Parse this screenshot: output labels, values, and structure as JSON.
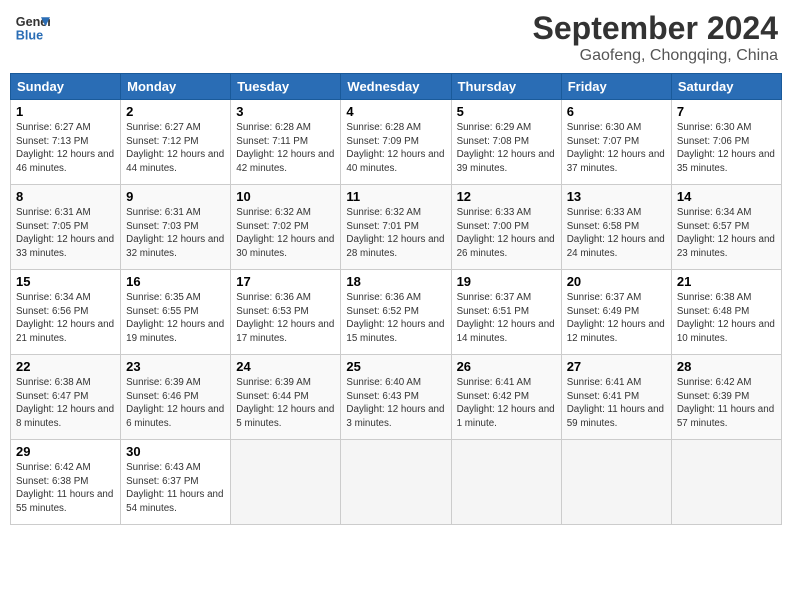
{
  "header": {
    "logo_line1": "General",
    "logo_line2": "Blue",
    "month_year": "September 2024",
    "location": "Gaofeng, Chongqing, China"
  },
  "days_of_week": [
    "Sunday",
    "Monday",
    "Tuesday",
    "Wednesday",
    "Thursday",
    "Friday",
    "Saturday"
  ],
  "weeks": [
    [
      {
        "day": 1,
        "sunrise": "6:27 AM",
        "sunset": "7:13 PM",
        "daylight": "12 hours and 46 minutes."
      },
      {
        "day": 2,
        "sunrise": "6:27 AM",
        "sunset": "7:12 PM",
        "daylight": "12 hours and 44 minutes."
      },
      {
        "day": 3,
        "sunrise": "6:28 AM",
        "sunset": "7:11 PM",
        "daylight": "12 hours and 42 minutes."
      },
      {
        "day": 4,
        "sunrise": "6:28 AM",
        "sunset": "7:09 PM",
        "daylight": "12 hours and 40 minutes."
      },
      {
        "day": 5,
        "sunrise": "6:29 AM",
        "sunset": "7:08 PM",
        "daylight": "12 hours and 39 minutes."
      },
      {
        "day": 6,
        "sunrise": "6:30 AM",
        "sunset": "7:07 PM",
        "daylight": "12 hours and 37 minutes."
      },
      {
        "day": 7,
        "sunrise": "6:30 AM",
        "sunset": "7:06 PM",
        "daylight": "12 hours and 35 minutes."
      }
    ],
    [
      {
        "day": 8,
        "sunrise": "6:31 AM",
        "sunset": "7:05 PM",
        "daylight": "12 hours and 33 minutes."
      },
      {
        "day": 9,
        "sunrise": "6:31 AM",
        "sunset": "7:03 PM",
        "daylight": "12 hours and 32 minutes."
      },
      {
        "day": 10,
        "sunrise": "6:32 AM",
        "sunset": "7:02 PM",
        "daylight": "12 hours and 30 minutes."
      },
      {
        "day": 11,
        "sunrise": "6:32 AM",
        "sunset": "7:01 PM",
        "daylight": "12 hours and 28 minutes."
      },
      {
        "day": 12,
        "sunrise": "6:33 AM",
        "sunset": "7:00 PM",
        "daylight": "12 hours and 26 minutes."
      },
      {
        "day": 13,
        "sunrise": "6:33 AM",
        "sunset": "6:58 PM",
        "daylight": "12 hours and 24 minutes."
      },
      {
        "day": 14,
        "sunrise": "6:34 AM",
        "sunset": "6:57 PM",
        "daylight": "12 hours and 23 minutes."
      }
    ],
    [
      {
        "day": 15,
        "sunrise": "6:34 AM",
        "sunset": "6:56 PM",
        "daylight": "12 hours and 21 minutes."
      },
      {
        "day": 16,
        "sunrise": "6:35 AM",
        "sunset": "6:55 PM",
        "daylight": "12 hours and 19 minutes."
      },
      {
        "day": 17,
        "sunrise": "6:36 AM",
        "sunset": "6:53 PM",
        "daylight": "12 hours and 17 minutes."
      },
      {
        "day": 18,
        "sunrise": "6:36 AM",
        "sunset": "6:52 PM",
        "daylight": "12 hours and 15 minutes."
      },
      {
        "day": 19,
        "sunrise": "6:37 AM",
        "sunset": "6:51 PM",
        "daylight": "12 hours and 14 minutes."
      },
      {
        "day": 20,
        "sunrise": "6:37 AM",
        "sunset": "6:49 PM",
        "daylight": "12 hours and 12 minutes."
      },
      {
        "day": 21,
        "sunrise": "6:38 AM",
        "sunset": "6:48 PM",
        "daylight": "12 hours and 10 minutes."
      }
    ],
    [
      {
        "day": 22,
        "sunrise": "6:38 AM",
        "sunset": "6:47 PM",
        "daylight": "12 hours and 8 minutes."
      },
      {
        "day": 23,
        "sunrise": "6:39 AM",
        "sunset": "6:46 PM",
        "daylight": "12 hours and 6 minutes."
      },
      {
        "day": 24,
        "sunrise": "6:39 AM",
        "sunset": "6:44 PM",
        "daylight": "12 hours and 5 minutes."
      },
      {
        "day": 25,
        "sunrise": "6:40 AM",
        "sunset": "6:43 PM",
        "daylight": "12 hours and 3 minutes."
      },
      {
        "day": 26,
        "sunrise": "6:41 AM",
        "sunset": "6:42 PM",
        "daylight": "12 hours and 1 minute."
      },
      {
        "day": 27,
        "sunrise": "6:41 AM",
        "sunset": "6:41 PM",
        "daylight": "11 hours and 59 minutes."
      },
      {
        "day": 28,
        "sunrise": "6:42 AM",
        "sunset": "6:39 PM",
        "daylight": "11 hours and 57 minutes."
      }
    ],
    [
      {
        "day": 29,
        "sunrise": "6:42 AM",
        "sunset": "6:38 PM",
        "daylight": "11 hours and 55 minutes."
      },
      {
        "day": 30,
        "sunrise": "6:43 AM",
        "sunset": "6:37 PM",
        "daylight": "11 hours and 54 minutes."
      },
      null,
      null,
      null,
      null,
      null
    ]
  ]
}
